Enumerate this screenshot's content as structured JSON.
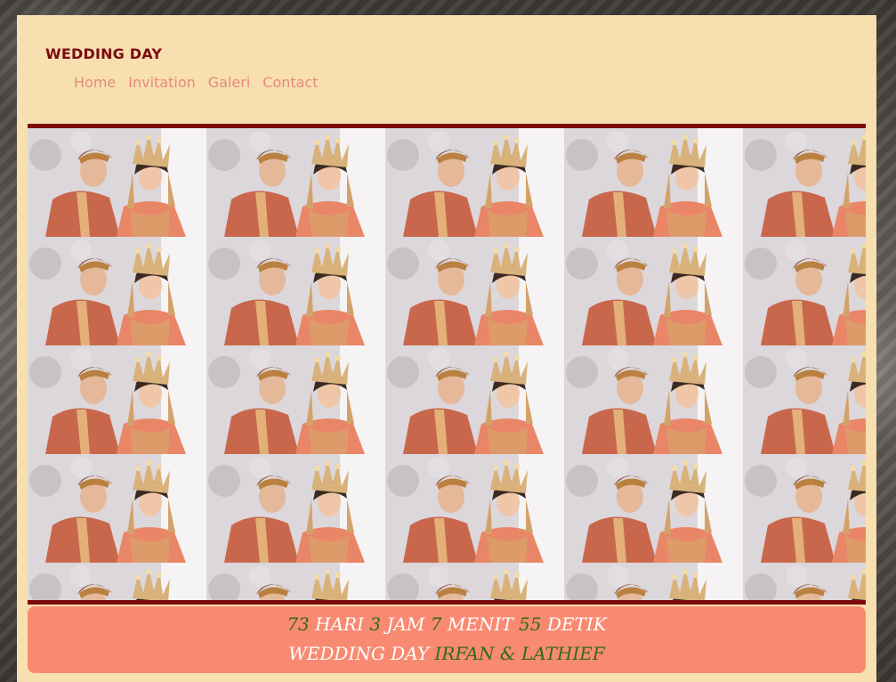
{
  "header": {
    "brand": "WEDDING DAY",
    "nav": [
      {
        "label": "Home"
      },
      {
        "label": "Invitation"
      },
      {
        "label": "Galeri"
      },
      {
        "label": "Contact"
      }
    ]
  },
  "hero": {
    "image_subject": "wedding-couple-photo",
    "border_color": "#7d0a0a"
  },
  "countdown": {
    "days": "73",
    "days_label": "HARI",
    "hours": "3",
    "hours_label": "JAM",
    "minutes": "7",
    "minutes_label": "MENIT",
    "seconds": "55",
    "seconds_label": "DETIK",
    "event_label": "WEDDING DAY",
    "names": "IRFAN & LATHIEF"
  },
  "colors": {
    "page_bg": "#f7dfb0",
    "brand": "#7a0a14",
    "nav": "#e68b78",
    "countdown_bg": "#f98a72",
    "countdown_number": "#2f6b12",
    "countdown_label": "#ffffff"
  }
}
